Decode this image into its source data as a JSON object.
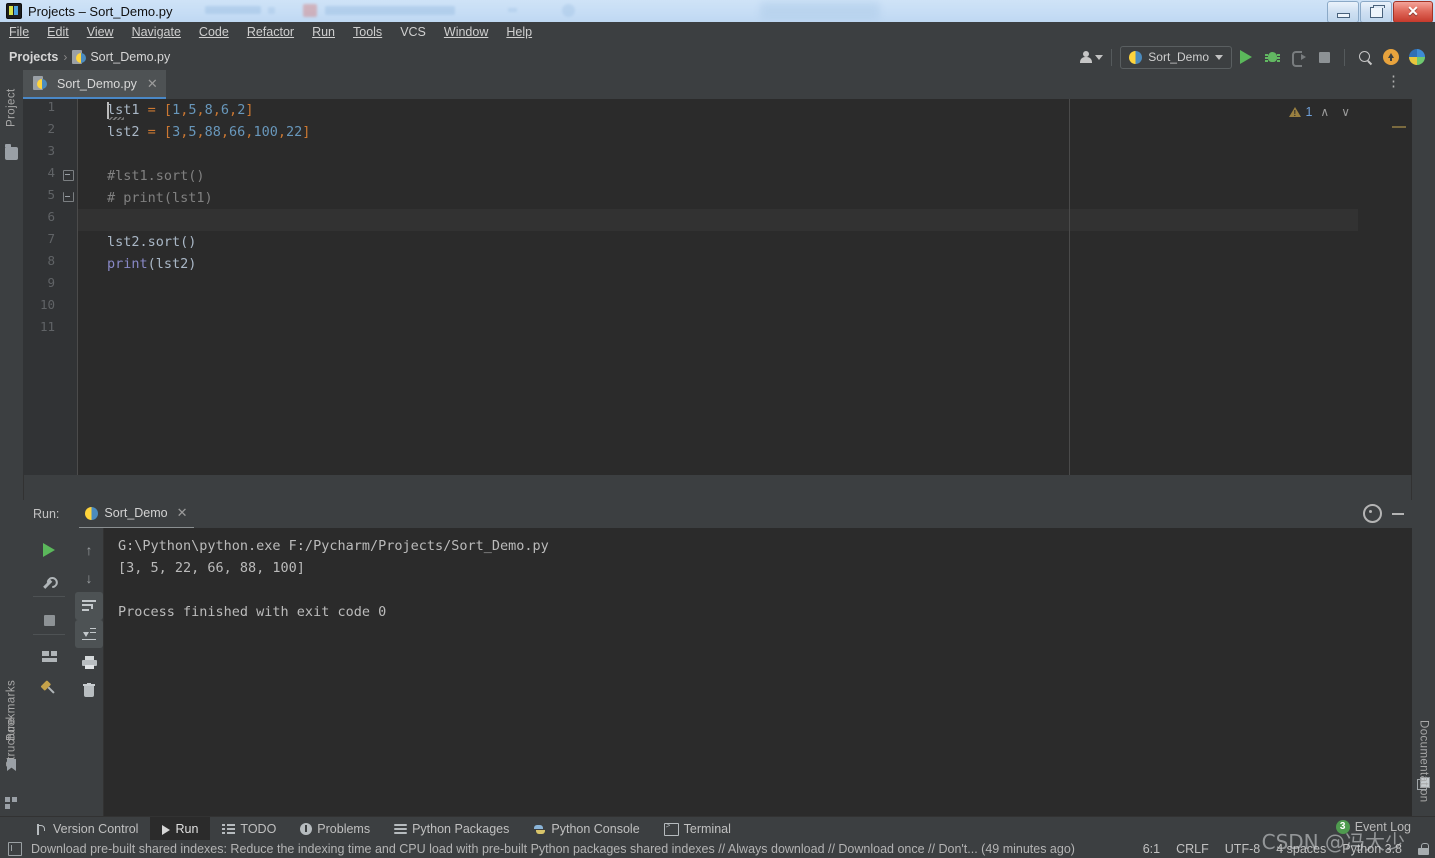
{
  "window": {
    "title": "Projects – Sort_Demo.py",
    "app_icon": "pycharm-icon",
    "minimize": "minimize",
    "maximize": "restore",
    "close": "✕"
  },
  "menubar": {
    "items": [
      {
        "label": "File",
        "mnemonic": "F"
      },
      {
        "label": "Edit",
        "mnemonic": "E"
      },
      {
        "label": "View",
        "mnemonic": "V"
      },
      {
        "label": "Navigate",
        "mnemonic": "N"
      },
      {
        "label": "Code",
        "mnemonic": "C"
      },
      {
        "label": "Refactor",
        "mnemonic": "R"
      },
      {
        "label": "Run",
        "mnemonic": "R"
      },
      {
        "label": "Tools",
        "mnemonic": "T"
      },
      {
        "label": "VCS",
        "mnemonic": ""
      },
      {
        "label": "Window",
        "mnemonic": "W"
      },
      {
        "label": "Help",
        "mnemonic": "H"
      }
    ]
  },
  "navbar": {
    "breadcrumb_root": "Projects",
    "breadcrumb_sep": "›",
    "breadcrumb_file": "Sort_Demo.py",
    "run_config": "Sort_Demo",
    "buttons": {
      "user": "user-account",
      "run": "Run",
      "debug": "Debug",
      "coverage": "Run with Coverage",
      "stop": "Stop",
      "search": "Search Everywhere",
      "update": "Update Project",
      "ai": "AI Assistant"
    }
  },
  "left_sidebar": {
    "items": [
      {
        "label": "Project",
        "icon": "folder-icon"
      },
      {
        "label": "Structure",
        "icon": "structure-icon"
      },
      {
        "label": "Bookmarks",
        "icon": "bookmark-icon"
      }
    ]
  },
  "right_sidebar": {
    "items": [
      {
        "label": "Documentation",
        "icon": "documentation-icon"
      }
    ]
  },
  "editor": {
    "tab": {
      "label": "Sort_Demo.py",
      "close": "✕",
      "icon": "python-file-icon"
    },
    "more_actions": "⋮",
    "inspection": {
      "count": "1",
      "up": "∧",
      "down": "∨"
    },
    "caret_line": 6,
    "lines": [
      {
        "num": "1",
        "tokens": [
          {
            "t": "lst1 ",
            "c": "def"
          },
          {
            "t": "=",
            "c": "punc"
          },
          {
            "t": " ",
            "c": "def"
          },
          {
            "t": "[",
            "c": "punc"
          },
          {
            "t": "1",
            "c": "num"
          },
          {
            "t": ",",
            "c": "punc"
          },
          {
            "t": "5",
            "c": "num"
          },
          {
            "t": ",",
            "c": "punc"
          },
          {
            "t": "8",
            "c": "num"
          },
          {
            "t": ",",
            "c": "punc"
          },
          {
            "t": "6",
            "c": "num"
          },
          {
            "t": ",",
            "c": "punc"
          },
          {
            "t": "2",
            "c": "num"
          },
          {
            "t": "]",
            "c": "punc"
          }
        ]
      },
      {
        "num": "2",
        "tokens": [
          {
            "t": "lst2 ",
            "c": "def"
          },
          {
            "t": "=",
            "c": "punc"
          },
          {
            "t": " ",
            "c": "def"
          },
          {
            "t": "[",
            "c": "punc"
          },
          {
            "t": "3",
            "c": "num"
          },
          {
            "t": ",",
            "c": "punc"
          },
          {
            "t": "5",
            "c": "num"
          },
          {
            "t": ",",
            "c": "punc"
          },
          {
            "t": "88",
            "c": "num"
          },
          {
            "t": ",",
            "c": "punc"
          },
          {
            "t": "66",
            "c": "num"
          },
          {
            "t": ",",
            "c": "punc"
          },
          {
            "t": "100",
            "c": "num"
          },
          {
            "t": ",",
            "c": "punc"
          },
          {
            "t": "22",
            "c": "num"
          },
          {
            "t": "]",
            "c": "punc"
          }
        ]
      },
      {
        "num": "3",
        "tokens": []
      },
      {
        "num": "4",
        "tokens": [
          {
            "t": "#lst1.sort()",
            "c": "cmt"
          }
        ]
      },
      {
        "num": "5",
        "tokens": [
          {
            "t": "# print(lst1)",
            "c": "cmt"
          }
        ]
      },
      {
        "num": "6",
        "tokens": []
      },
      {
        "num": "7",
        "tokens": [
          {
            "t": "lst2.sort()",
            "c": "def"
          }
        ]
      },
      {
        "num": "8",
        "tokens": [
          {
            "t": "print",
            "c": "blt"
          },
          {
            "t": "(lst2)",
            "c": "def"
          }
        ]
      },
      {
        "num": "9",
        "tokens": []
      },
      {
        "num": "10",
        "tokens": []
      },
      {
        "num": "11",
        "tokens": []
      }
    ]
  },
  "run_panel": {
    "label": "Run:",
    "tab": {
      "label": "Sort_Demo",
      "close": "✕",
      "icon": "python-icon"
    },
    "header_actions": [
      {
        "name": "settings-icon",
        "label": "Settings"
      },
      {
        "name": "hide-icon",
        "label": "Hide"
      }
    ],
    "left_tools": [
      {
        "name": "rerun-icon",
        "label": "Rerun"
      },
      {
        "name": "wrench-icon",
        "label": "Modify Run Configuration"
      },
      {
        "name": "stop-icon",
        "label": "Stop"
      },
      {
        "name": "layout-icon",
        "label": "Layout Settings"
      },
      {
        "name": "pin-icon",
        "label": "Pin Tab"
      }
    ],
    "right_tools": [
      {
        "name": "arrow-up-icon",
        "label": "Up"
      },
      {
        "name": "arrow-down-icon",
        "label": "Down"
      },
      {
        "name": "soft-wrap-icon",
        "label": "Soft-Wrap"
      },
      {
        "name": "scroll-to-end-icon",
        "label": "Scroll to End"
      },
      {
        "name": "print-icon",
        "label": "Print"
      },
      {
        "name": "trash-icon",
        "label": "Clear All"
      }
    ],
    "console_lines": [
      "G:\\Python\\python.exe F:/Pycharm/Projects/Sort_Demo.py",
      "[3, 5, 22, 66, 88, 100]",
      "",
      "Process finished with exit code 0"
    ]
  },
  "bottom_tabs": [
    {
      "label": "Version Control",
      "icon": "branch-icon",
      "active": false
    },
    {
      "label": "Run",
      "icon": "run-icon",
      "active": true
    },
    {
      "label": "TODO",
      "icon": "todo-icon",
      "active": false
    },
    {
      "label": "Problems",
      "icon": "problems-icon",
      "active": false
    },
    {
      "label": "Python Packages",
      "icon": "packages-icon",
      "active": false
    },
    {
      "label": "Python Console",
      "icon": "python-console-icon",
      "active": false
    },
    {
      "label": "Terminal",
      "icon": "terminal-icon",
      "active": false
    }
  ],
  "statusbar": {
    "message": "Download pre-built shared indexes: Reduce the indexing time and CPU load with pre-built Python packages shared indexes // Always download // Download once // Don't... (49 minutes ago)",
    "caret_position": "6:1",
    "line_separator": "CRLF",
    "encoding": "UTF-8",
    "indent": "4 spaces",
    "interpreter": "Python 3.8",
    "lock": "lock-icon"
  },
  "event_log": {
    "label": "Event Log",
    "badge": "3"
  },
  "watermark": {
    "text": "CSDN @冯大少"
  },
  "colors": {
    "titlebar": "#c6ddf5",
    "chrome": "#3c3f41",
    "editor_bg": "#2b2b2b",
    "gutter_bg": "#313335",
    "accent_tab": "#4a88c7",
    "number": "#6897bb",
    "punctuation": "#cc7832",
    "comment": "#808080",
    "builtin": "#8888c6",
    "default_text": "#a9b7c6",
    "run_green": "#5bb85b"
  }
}
